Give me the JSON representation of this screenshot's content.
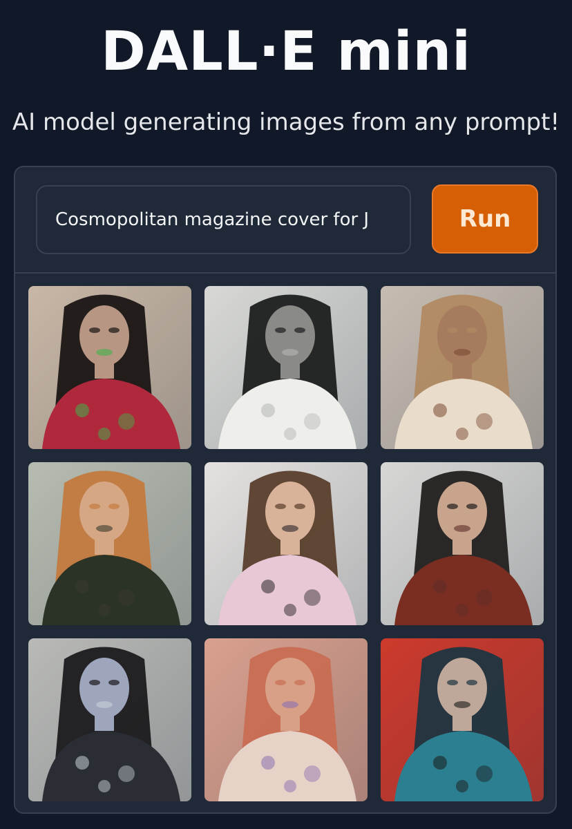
{
  "header": {
    "title": "DALL·E mini",
    "subtitle": "AI model generating images from any prompt!"
  },
  "prompt": {
    "value": "Cosmopolitan magazine cover for J",
    "run_label": "Run",
    "run_color": "#d65f05"
  },
  "results": {
    "images": [
      {
        "name": "generated-image-1",
        "bg": "#c8b7a6",
        "hair": "#1a1514",
        "skin": "#b89684",
        "garment": "#b0283c",
        "accent": "#3fb34a"
      },
      {
        "name": "generated-image-2",
        "bg": "#d8d9d6",
        "hair": "#1c1e1e",
        "skin": "#8a8a87",
        "garment": "#eeeeea",
        "accent": "#b5b8b3"
      },
      {
        "name": "generated-image-3",
        "bg": "#c6bcb1",
        "hair": "#b08a63",
        "skin": "#a67b5e",
        "garment": "#e9dccb",
        "accent": "#7a4a33"
      },
      {
        "name": "generated-image-4",
        "bg": "#b7bcb1",
        "hair": "#c37a3f",
        "skin": "#d6a785",
        "garment": "#2b3326",
        "accent": "#3b3a2f"
      },
      {
        "name": "generated-image-5",
        "bg": "#e4e2e0",
        "hair": "#5a3e2b",
        "skin": "#d9b29a",
        "garment": "#e8c7d6",
        "accent": "#2a2629"
      },
      {
        "name": "generated-image-6",
        "bg": "#d7d7d5",
        "hair": "#22201e",
        "skin": "#c9a48d",
        "garment": "#7a2e22",
        "accent": "#5d2d28"
      },
      {
        "name": "generated-image-7",
        "bg": "#b9bab7",
        "hair": "#1b1a1c",
        "skin": "#9ea6bd",
        "garment": "#2a2d33",
        "accent": "#c7d1d6"
      },
      {
        "name": "generated-image-8",
        "bg": "#d9a08e",
        "hair": "#c86d52",
        "skin": "#d8a187",
        "garment": "#e7d2c7",
        "accent": "#8b6fb0"
      },
      {
        "name": "generated-image-9",
        "bg": "#cc3a2d",
        "hair": "#1e3540",
        "skin": "#bfa89a",
        "garment": "#2c7f91",
        "accent": "#1a1a1a"
      }
    ]
  }
}
